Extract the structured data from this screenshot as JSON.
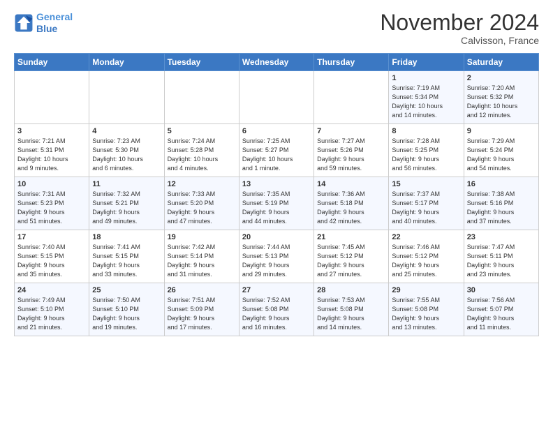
{
  "logo": {
    "line1": "General",
    "line2": "Blue"
  },
  "title": "November 2024",
  "location": "Calvisson, France",
  "days_of_week": [
    "Sunday",
    "Monday",
    "Tuesday",
    "Wednesday",
    "Thursday",
    "Friday",
    "Saturday"
  ],
  "weeks": [
    [
      {
        "day": "",
        "info": ""
      },
      {
        "day": "",
        "info": ""
      },
      {
        "day": "",
        "info": ""
      },
      {
        "day": "",
        "info": ""
      },
      {
        "day": "",
        "info": ""
      },
      {
        "day": "1",
        "info": "Sunrise: 7:19 AM\nSunset: 5:34 PM\nDaylight: 10 hours\nand 14 minutes."
      },
      {
        "day": "2",
        "info": "Sunrise: 7:20 AM\nSunset: 5:32 PM\nDaylight: 10 hours\nand 12 minutes."
      }
    ],
    [
      {
        "day": "3",
        "info": "Sunrise: 7:21 AM\nSunset: 5:31 PM\nDaylight: 10 hours\nand 9 minutes."
      },
      {
        "day": "4",
        "info": "Sunrise: 7:23 AM\nSunset: 5:30 PM\nDaylight: 10 hours\nand 6 minutes."
      },
      {
        "day": "5",
        "info": "Sunrise: 7:24 AM\nSunset: 5:28 PM\nDaylight: 10 hours\nand 4 minutes."
      },
      {
        "day": "6",
        "info": "Sunrise: 7:25 AM\nSunset: 5:27 PM\nDaylight: 10 hours\nand 1 minute."
      },
      {
        "day": "7",
        "info": "Sunrise: 7:27 AM\nSunset: 5:26 PM\nDaylight: 9 hours\nand 59 minutes."
      },
      {
        "day": "8",
        "info": "Sunrise: 7:28 AM\nSunset: 5:25 PM\nDaylight: 9 hours\nand 56 minutes."
      },
      {
        "day": "9",
        "info": "Sunrise: 7:29 AM\nSunset: 5:24 PM\nDaylight: 9 hours\nand 54 minutes."
      }
    ],
    [
      {
        "day": "10",
        "info": "Sunrise: 7:31 AM\nSunset: 5:23 PM\nDaylight: 9 hours\nand 51 minutes."
      },
      {
        "day": "11",
        "info": "Sunrise: 7:32 AM\nSunset: 5:21 PM\nDaylight: 9 hours\nand 49 minutes."
      },
      {
        "day": "12",
        "info": "Sunrise: 7:33 AM\nSunset: 5:20 PM\nDaylight: 9 hours\nand 47 minutes."
      },
      {
        "day": "13",
        "info": "Sunrise: 7:35 AM\nSunset: 5:19 PM\nDaylight: 9 hours\nand 44 minutes."
      },
      {
        "day": "14",
        "info": "Sunrise: 7:36 AM\nSunset: 5:18 PM\nDaylight: 9 hours\nand 42 minutes."
      },
      {
        "day": "15",
        "info": "Sunrise: 7:37 AM\nSunset: 5:17 PM\nDaylight: 9 hours\nand 40 minutes."
      },
      {
        "day": "16",
        "info": "Sunrise: 7:38 AM\nSunset: 5:16 PM\nDaylight: 9 hours\nand 37 minutes."
      }
    ],
    [
      {
        "day": "17",
        "info": "Sunrise: 7:40 AM\nSunset: 5:15 PM\nDaylight: 9 hours\nand 35 minutes."
      },
      {
        "day": "18",
        "info": "Sunrise: 7:41 AM\nSunset: 5:15 PM\nDaylight: 9 hours\nand 33 minutes."
      },
      {
        "day": "19",
        "info": "Sunrise: 7:42 AM\nSunset: 5:14 PM\nDaylight: 9 hours\nand 31 minutes."
      },
      {
        "day": "20",
        "info": "Sunrise: 7:44 AM\nSunset: 5:13 PM\nDaylight: 9 hours\nand 29 minutes."
      },
      {
        "day": "21",
        "info": "Sunrise: 7:45 AM\nSunset: 5:12 PM\nDaylight: 9 hours\nand 27 minutes."
      },
      {
        "day": "22",
        "info": "Sunrise: 7:46 AM\nSunset: 5:12 PM\nDaylight: 9 hours\nand 25 minutes."
      },
      {
        "day": "23",
        "info": "Sunrise: 7:47 AM\nSunset: 5:11 PM\nDaylight: 9 hours\nand 23 minutes."
      }
    ],
    [
      {
        "day": "24",
        "info": "Sunrise: 7:49 AM\nSunset: 5:10 PM\nDaylight: 9 hours\nand 21 minutes."
      },
      {
        "day": "25",
        "info": "Sunrise: 7:50 AM\nSunset: 5:10 PM\nDaylight: 9 hours\nand 19 minutes."
      },
      {
        "day": "26",
        "info": "Sunrise: 7:51 AM\nSunset: 5:09 PM\nDaylight: 9 hours\nand 17 minutes."
      },
      {
        "day": "27",
        "info": "Sunrise: 7:52 AM\nSunset: 5:08 PM\nDaylight: 9 hours\nand 16 minutes."
      },
      {
        "day": "28",
        "info": "Sunrise: 7:53 AM\nSunset: 5:08 PM\nDaylight: 9 hours\nand 14 minutes."
      },
      {
        "day": "29",
        "info": "Sunrise: 7:55 AM\nSunset: 5:08 PM\nDaylight: 9 hours\nand 13 minutes."
      },
      {
        "day": "30",
        "info": "Sunrise: 7:56 AM\nSunset: 5:07 PM\nDaylight: 9 hours\nand 11 minutes."
      }
    ]
  ]
}
